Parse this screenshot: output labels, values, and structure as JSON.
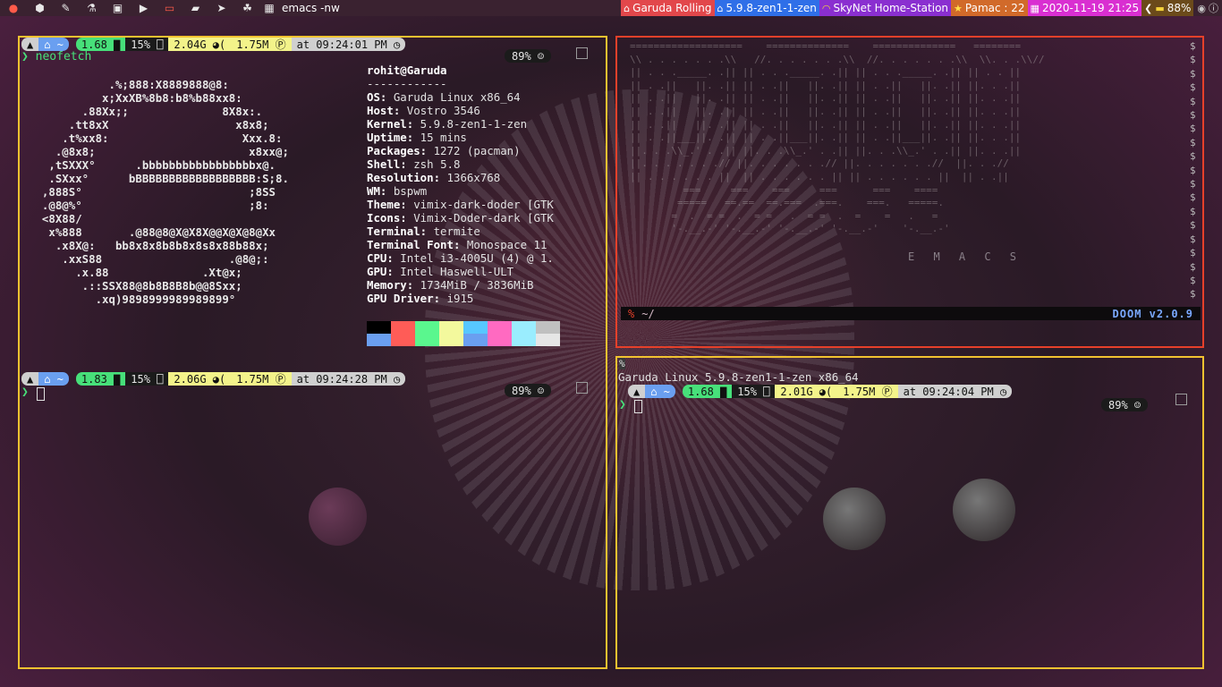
{
  "colors": {
    "bar_bg": "#3a2230",
    "border_normal": "#f2c230",
    "border_focused": "#e6402a",
    "load_green": "#47e07a",
    "home_blue": "#6a9ff0",
    "ram_yellow": "#f3f38a"
  },
  "topbar": {
    "launchers": [
      "garuda-logo-icon",
      "apps-grid-icon",
      "color-picker-icon",
      "flask-icon",
      "image-viewer-icon",
      "video-icon",
      "terminal-icon",
      "file-manager-icon",
      "telegram-icon",
      "paw-icon",
      "window-grid-icon"
    ],
    "window_title": "emacs -nw",
    "modules": [
      {
        "id": "distro",
        "icon": "bank-icon",
        "text": "Garuda Rolling",
        "bg": "#e2474b"
      },
      {
        "id": "kernel",
        "icon": "bank-icon",
        "text": "5.9.8-zen1-1-zen",
        "bg": "#2f6fe8"
      },
      {
        "id": "wifi",
        "icon": "wifi-icon",
        "text": "SkyNet Home-Station",
        "bg": "#8a2fd0"
      },
      {
        "id": "updates",
        "icon": "star-icon",
        "text": "Pamac : 22",
        "bg": "#d16a2a"
      },
      {
        "id": "date",
        "icon": "calendar-icon",
        "text": "2020-11-19 21:25",
        "bg": "#d92fd1"
      },
      {
        "id": "battery",
        "icon": "battery-icon",
        "text": "88%",
        "bg": "#6b4a1a"
      }
    ]
  },
  "windows": {
    "left": {
      "command": "neofetch",
      "prompt_top": {
        "load": "1.68",
        "cpu": "15%",
        "ram": "2.04G",
        "net": "1.75M",
        "time": "at 09:24:01 PM",
        "battery": "89%"
      },
      "prompt_bottom": {
        "load": "1.83",
        "cpu": "15%",
        "ram": "2.06G",
        "net": "1.75M",
        "time": "at 09:24:28 PM",
        "battery": "89%"
      },
      "ascii_art": "            .%;888:X8889888@8:\n           x;XxXB%8b8:b8%b88xx8:\n        .88Xx;;              8X8x:.\n      .tt8xX                   x8x8;\n     .t%xx8:                    Xxx.8:\n    .@8x8;                       x8xx@;\n   ,tSXXX°      .bbbbbbbbbbbbbbbbbx@.\n   .SXxx°      bBBBBBBBBBBBBBBBBBB:S;8.\n  ,888S°                         ;8SS\n  .@8@%°                         ;8:\n  <8X88/\n   x%888       .@88@8@X@X8X@@X@X@8@Xx\n    .x8X@:   bb8x8x8b8b8x8s8x88b88x;\n     .xxS88                   .@8@;:\n       .x.88              .Xt@x;\n        .::SSX88@8b8B8B8b@@8Sxx;\n          .xq)9898999989989899°",
      "user_host": "rohit@Garuda",
      "separator": "------------",
      "info": [
        {
          "key": "OS",
          "value": "Garuda Linux x86_64"
        },
        {
          "key": "Host",
          "value": "Vostro 3546"
        },
        {
          "key": "Kernel",
          "value": "5.9.8-zen1-1-zen"
        },
        {
          "key": "Uptime",
          "value": "15 mins"
        },
        {
          "key": "Packages",
          "value": "1272 (pacman)"
        },
        {
          "key": "Shell",
          "value": "zsh 5.8"
        },
        {
          "key": "Resolution",
          "value": "1366x768"
        },
        {
          "key": "WM",
          "value": "bspwm"
        },
        {
          "key": "Theme",
          "value": "vimix-dark-doder [GTK"
        },
        {
          "key": "Icons",
          "value": "Vimix-Doder-dark [GTK"
        },
        {
          "key": "Terminal",
          "value": "termite"
        },
        {
          "key": "Terminal Font",
          "value": "Monospace 11"
        },
        {
          "key": "CPU",
          "value": "Intel i3-4005U (4) @ 1."
        },
        {
          "key": "GPU",
          "value": "Intel Haswell-ULT"
        },
        {
          "key": "Memory",
          "value": "1734MiB / 3836MiB"
        },
        {
          "key": "GPU Driver",
          "value": "i915"
        }
      ],
      "palette_top": [
        "#000000",
        "#ff5c57",
        "#5af78e",
        "#f3f99d",
        "#57c7ff",
        "#ff6ac1",
        "#9aedfe",
        "#c0c0c0"
      ],
      "palette_bottom": [
        "#6a9ff0",
        "#ff5c57",
        "#5af78e",
        "#f3f99d",
        "#6a9ff0",
        "#ff6ac1",
        "#9aedfe",
        "#e6e6e6"
      ]
    },
    "emacs": {
      "banner_label": "E M A C S",
      "modeline_path": "~/",
      "modeline_percent": "%",
      "doom_version": "DOOM v2.0.9"
    },
    "right": {
      "percent_sign": "%",
      "uname": "Garuda Linux 5.9.8-zen1-1-zen x86_64",
      "prompt": {
        "load": "1.68",
        "cpu": "15%",
        "ram": "2.01G",
        "net": "1.75M",
        "time": "at 09:24:04 PM",
        "battery": "89%"
      }
    }
  }
}
